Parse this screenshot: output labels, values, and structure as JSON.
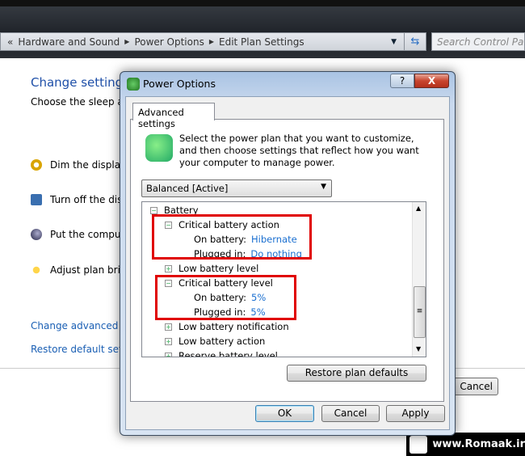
{
  "explorer": {
    "breadcrumb": [
      "Hardware and Sound",
      "Power Options",
      "Edit Plan Settings"
    ],
    "search_placeholder": "Search Control Panel"
  },
  "background": {
    "title": "Change settings",
    "subtitle": "Choose the sleep and",
    "items": [
      "Dim the display:",
      "Turn off the disp",
      "Put the compute",
      "Adjust plan brig"
    ],
    "links": [
      "Change advanced po",
      "Restore default setti"
    ],
    "cancel": "Cancel"
  },
  "dialog": {
    "title": "Power Options",
    "help": "?",
    "close": "X",
    "tab": "Advanced settings",
    "description": "Select the power plan that you want to customize, and then choose settings that reflect how you want your computer to manage power.",
    "plan": "Balanced [Active]",
    "tree": [
      {
        "label": "Battery",
        "level": 0,
        "state": "expanded"
      },
      {
        "label": "Critical battery action",
        "level": 1,
        "state": "expanded"
      },
      {
        "label": "On battery:",
        "value": "Hibernate",
        "level": 2
      },
      {
        "label": "Plugged in:",
        "value": "Do nothing",
        "level": 2
      },
      {
        "label": "Low battery level",
        "level": 1,
        "state": "collapsed"
      },
      {
        "label": "Critical battery level",
        "level": 1,
        "state": "expanded"
      },
      {
        "label": "On battery:",
        "value": "5%",
        "level": 2
      },
      {
        "label": "Plugged in:",
        "value": "5%",
        "level": 2
      },
      {
        "label": "Low battery notification",
        "level": 1,
        "state": "collapsed"
      },
      {
        "label": "Low battery action",
        "level": 1,
        "state": "collapsed"
      },
      {
        "label": "Reserve battery level",
        "level": 1,
        "state": "collapsed"
      }
    ],
    "restore": "Restore plan defaults",
    "ok": "OK",
    "cancel": "Cancel",
    "apply": "Apply"
  },
  "watermark": "www.Romaak.ir",
  "colors": {
    "highlight": "#e00000",
    "value_link": "#1a6fd0"
  }
}
